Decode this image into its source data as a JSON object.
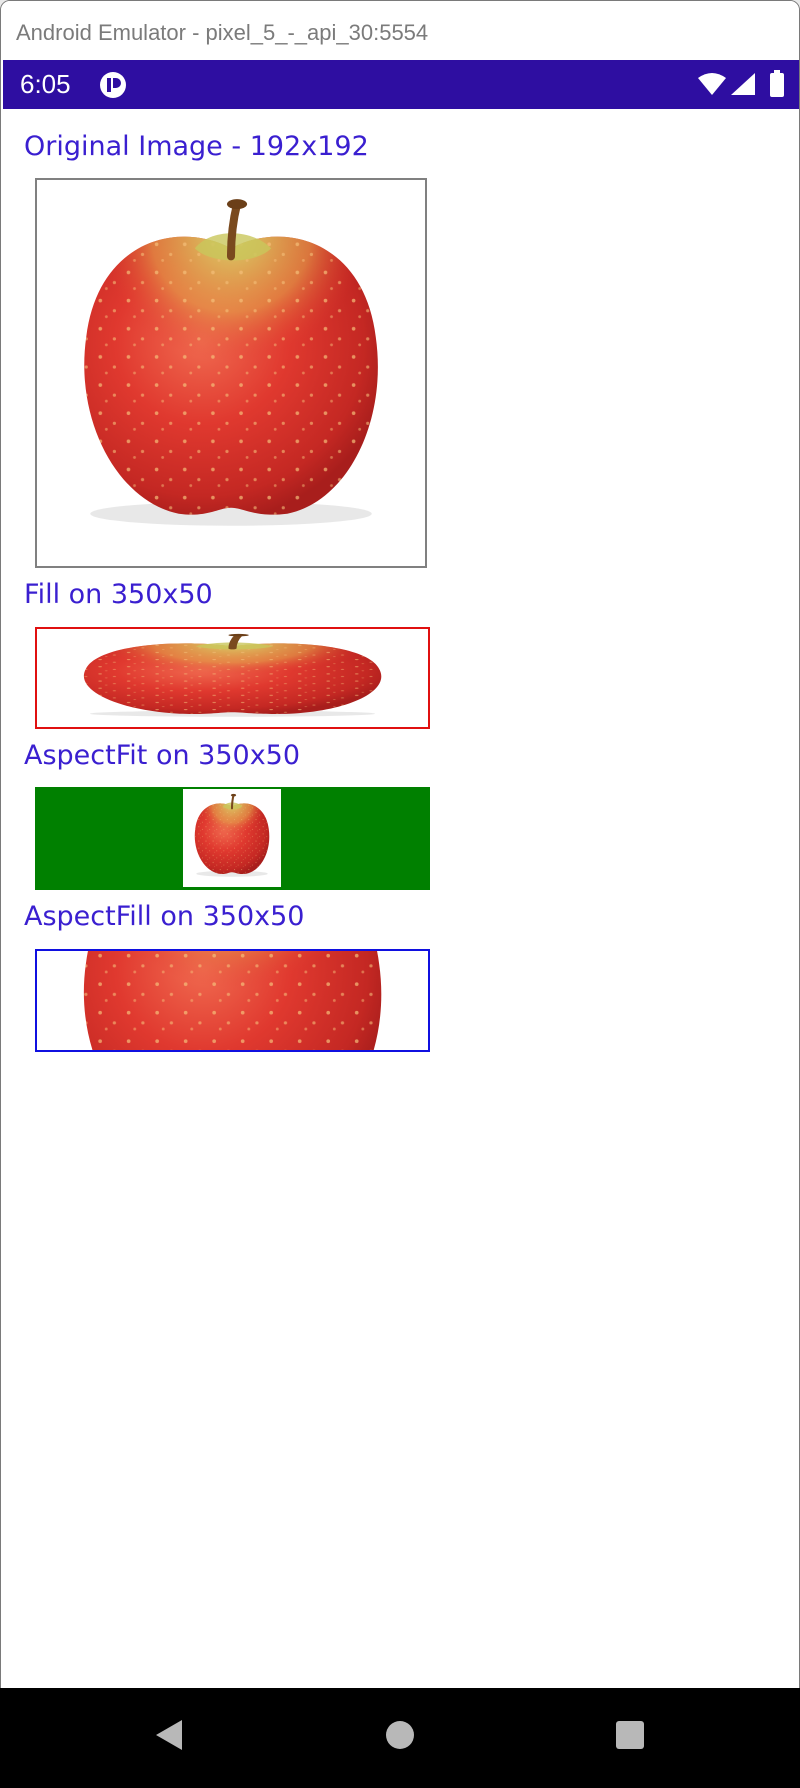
{
  "window": {
    "title": "Android Emulator - pixel_5_-_api_30:5554"
  },
  "statusbar": {
    "time": "6:05"
  },
  "sections": [
    {
      "label": "Original Image - 192x192"
    },
    {
      "label": "Fill on 350x50"
    },
    {
      "label": "AspectFit on 350x50"
    },
    {
      "label": "AspectFill on 350x50"
    }
  ],
  "colors": {
    "statusbar": "#2E0EA1",
    "label_text": "#3A1FD0",
    "original_border": "#808080",
    "fill_border": "#E01010",
    "aspectfit_background": "#008000",
    "aspectfill_border": "#1010E0",
    "navbar": "#000000"
  },
  "icons": {
    "statusbar": [
      "app-notification-icon",
      "wifi-icon",
      "cellular-signal-icon",
      "battery-icon"
    ],
    "navbar": [
      "back-icon",
      "home-icon",
      "recents-icon"
    ]
  }
}
